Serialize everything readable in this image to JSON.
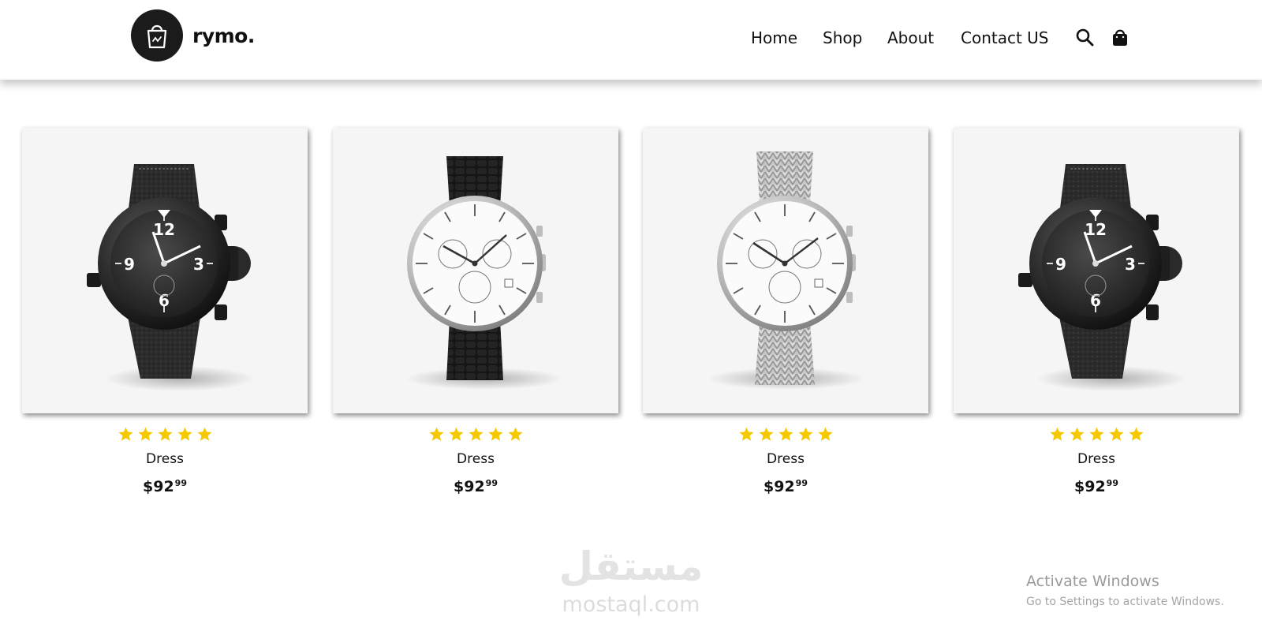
{
  "header": {
    "brand": "rymo.",
    "nav": [
      {
        "label": "Home"
      },
      {
        "label": "Shop"
      },
      {
        "label": "About"
      },
      {
        "label": "Contact US"
      }
    ],
    "icons": [
      "search-icon",
      "shopping-bag-icon"
    ]
  },
  "products": [
    {
      "title": "Dress",
      "price_main": "$92",
      "price_cents": "99",
      "rating": 5,
      "image": "black-chronograph-watch"
    },
    {
      "title": "Dress",
      "price_main": "$92",
      "price_cents": "99",
      "rating": 5,
      "image": "white-dial-leather-watch"
    },
    {
      "title": "Dress",
      "price_main": "$92",
      "price_cents": "99",
      "rating": 5,
      "image": "white-dial-mesh-watch"
    },
    {
      "title": "Dress",
      "price_main": "$92",
      "price_cents": "99",
      "rating": 5,
      "image": "black-chronograph-watch"
    }
  ],
  "watermark": {
    "arabic": "مستقل",
    "latin": "mostaql.com"
  },
  "os_notice": {
    "title": "Activate Windows",
    "subtitle": "Go to Settings to activate Windows."
  },
  "colors": {
    "star": "#f5c800",
    "text": "#111111",
    "card_bg": "#f5f5f5",
    "logo_bg": "#1b1b1b"
  }
}
